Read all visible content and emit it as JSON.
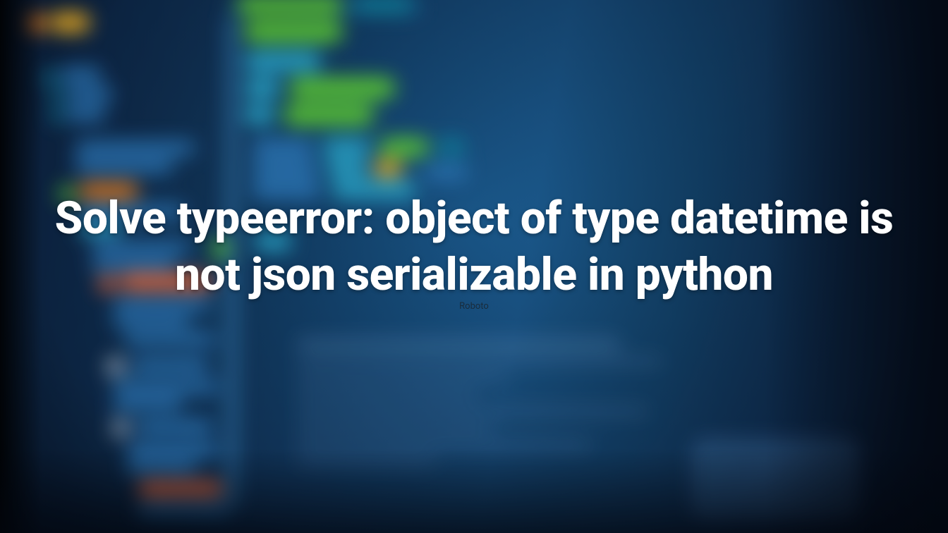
{
  "headline": "Solve typeerror: object of type datetime is not json serializable in python",
  "font_caption": "Roboto"
}
